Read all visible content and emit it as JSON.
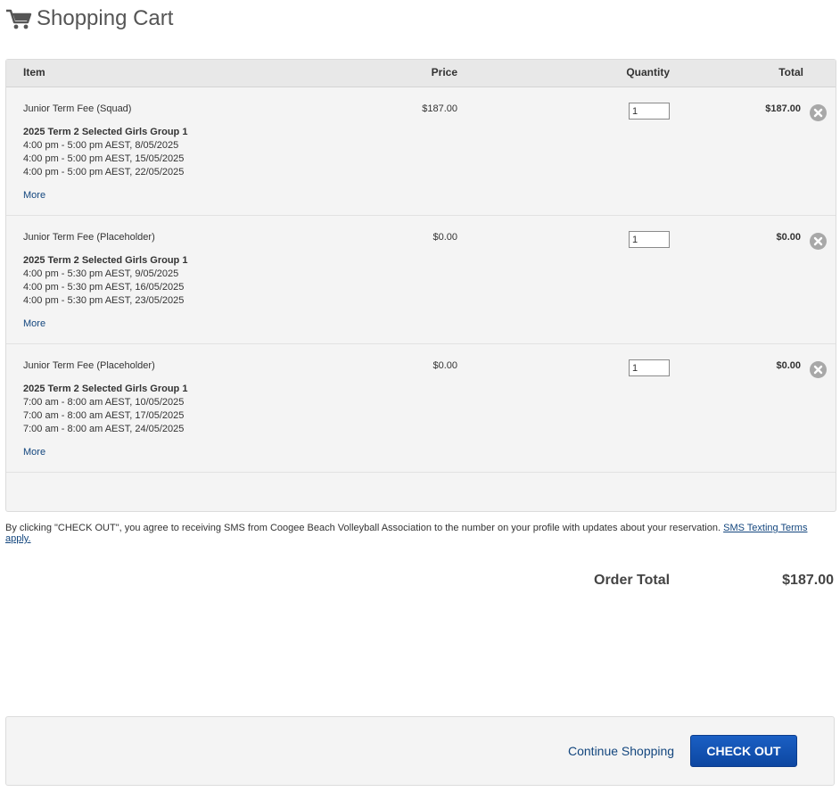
{
  "header": {
    "title": "Shopping Cart",
    "icon": "shopping-cart-icon"
  },
  "table": {
    "columns": {
      "item": "Item",
      "price": "Price",
      "quantity": "Quantity",
      "total": "Total"
    },
    "rows": [
      {
        "name": "Junior Term Fee (Squad)",
        "group": "2025 Term 2 Selected Girls Group 1",
        "sessions": [
          "4:00 pm - 5:00 pm AEST, 8/05/2025",
          "4:00 pm - 5:00 pm AEST, 15/05/2025",
          "4:00 pm - 5:00 pm AEST, 22/05/2025"
        ],
        "more": "More",
        "price": "$187.00",
        "quantity": "1",
        "total": "$187.00"
      },
      {
        "name": "Junior Term Fee (Placeholder)",
        "group": "2025 Term 2 Selected Girls Group 1",
        "sessions": [
          "4:00 pm - 5:30 pm AEST, 9/05/2025",
          "4:00 pm - 5:30 pm AEST, 16/05/2025",
          "4:00 pm - 5:30 pm AEST, 23/05/2025"
        ],
        "more": "More",
        "price": "$0.00",
        "quantity": "1",
        "total": "$0.00"
      },
      {
        "name": "Junior Term Fee (Placeholder)",
        "group": "2025 Term 2 Selected Girls Group 1",
        "sessions": [
          "7:00 am - 8:00 am AEST, 10/05/2025",
          "7:00 am - 8:00 am AEST, 17/05/2025",
          "7:00 am - 8:00 am AEST, 24/05/2025"
        ],
        "more": "More",
        "price": "$0.00",
        "quantity": "1",
        "total": "$0.00"
      }
    ]
  },
  "sms_note": {
    "text": "By clicking \"CHECK OUT\", you agree to receiving SMS from Coogee Beach Volleyball Association to the number on your profile with updates about your reservation.",
    "link": "SMS Texting Terms apply."
  },
  "order_total": {
    "label": "Order Total",
    "value": "$187.00"
  },
  "footer": {
    "continue_label": "Continue Shopping",
    "checkout_label": "CHECK OUT"
  },
  "colors": {
    "link": "#13467e",
    "button": "#0d47a1",
    "panel": "#f4f4f4",
    "header_row": "#e8e8e8"
  }
}
